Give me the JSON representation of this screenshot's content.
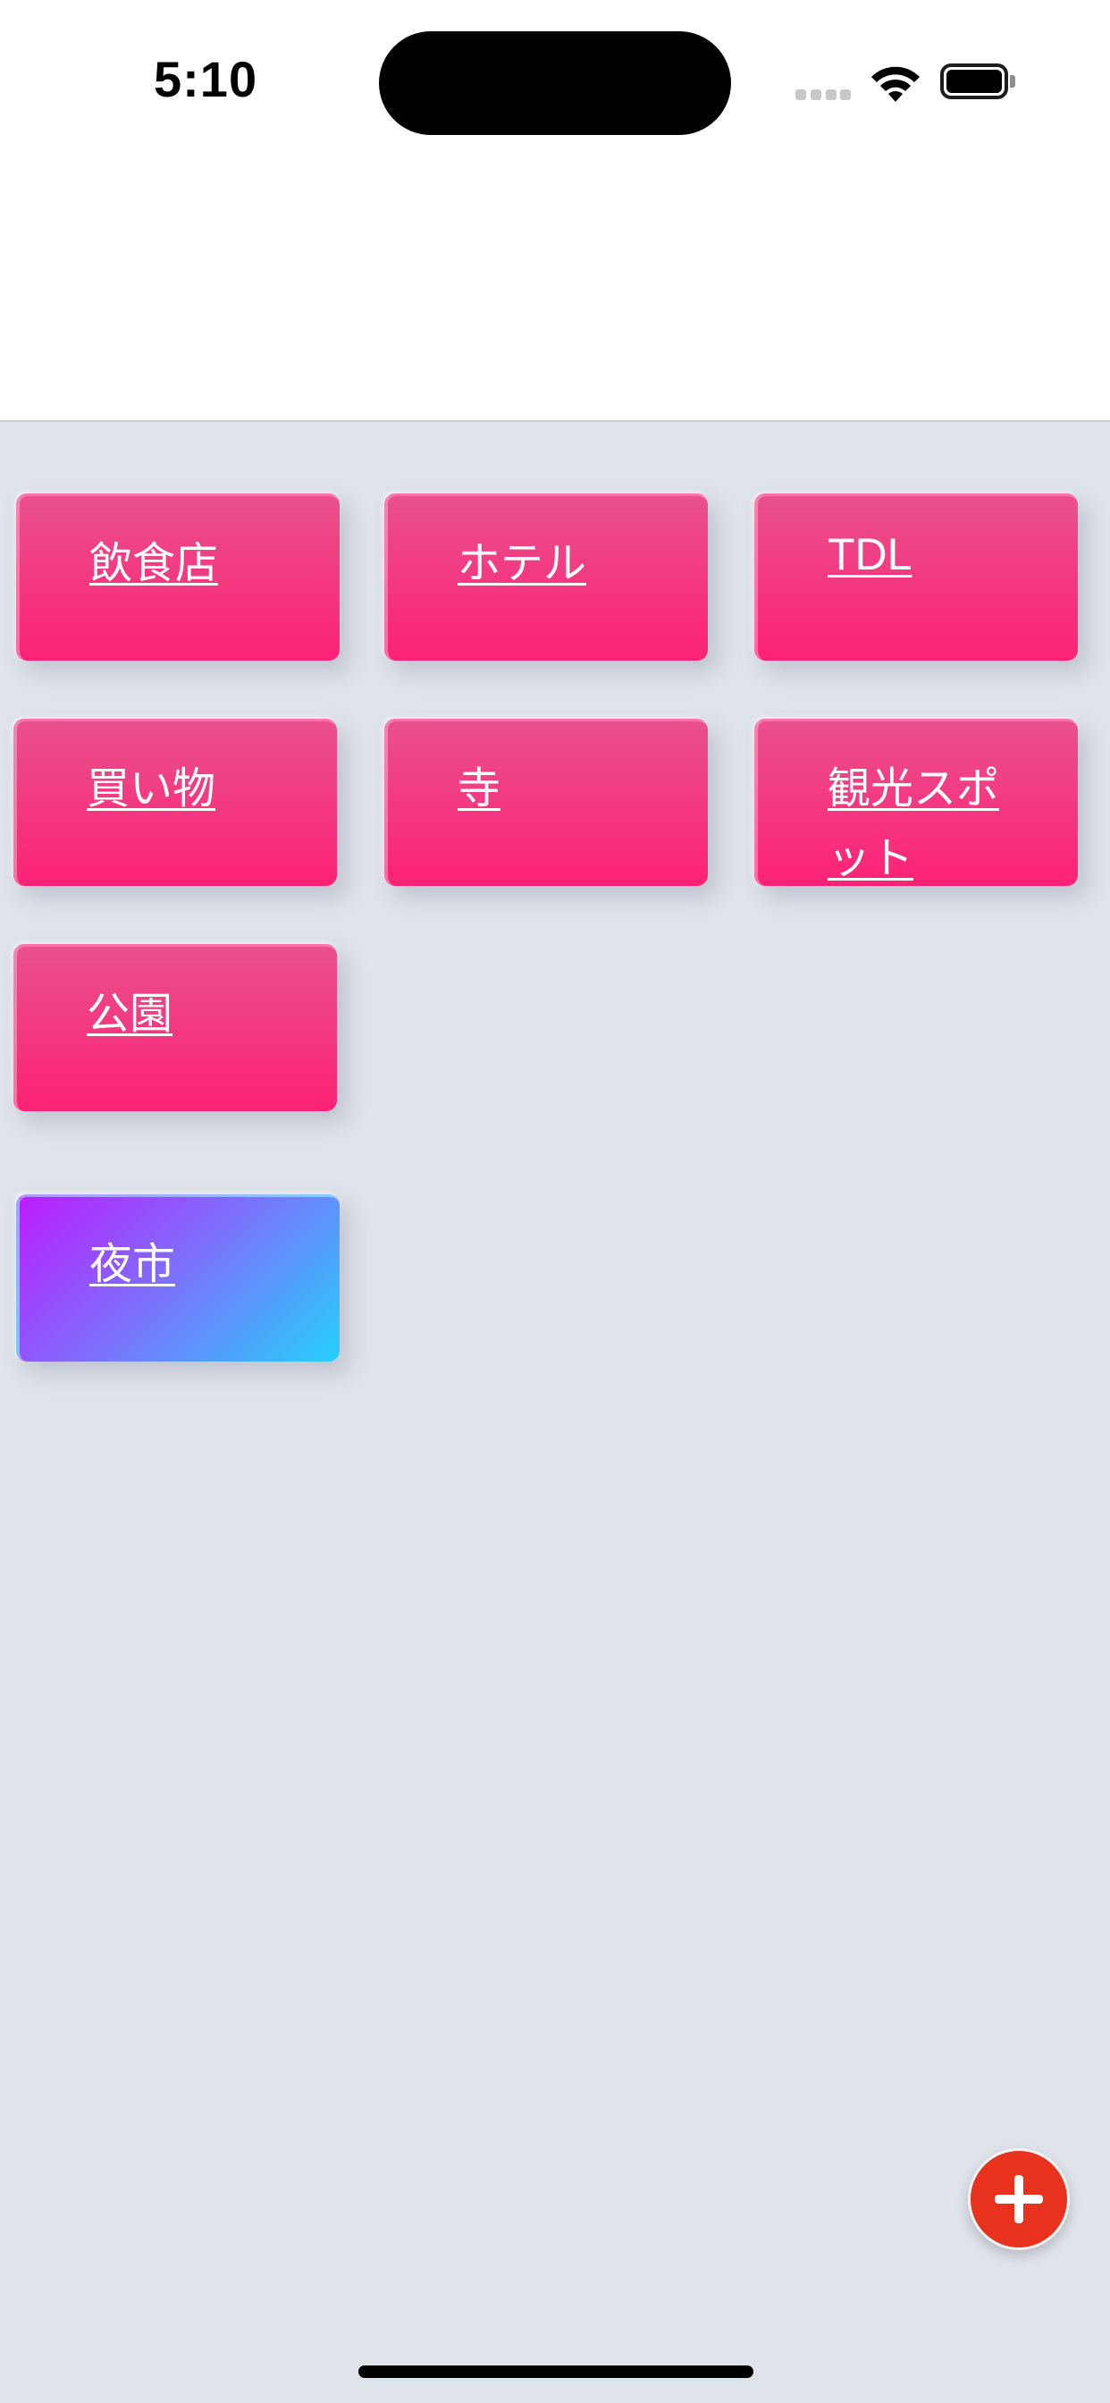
{
  "status_bar": {
    "time": "5:10"
  },
  "tiles": [
    {
      "label": "飲食店",
      "style": "pink"
    },
    {
      "label": "ホテル",
      "style": "pink"
    },
    {
      "label": "TDL",
      "style": "pink"
    },
    {
      "label": "買い物",
      "style": "pink"
    },
    {
      "label": "寺",
      "style": "pink"
    },
    {
      "label": "観光スポット",
      "style": "pink"
    },
    {
      "label": "公園",
      "style": "pink"
    },
    {
      "label": "夜市",
      "style": "gradient-purple-cyan"
    }
  ],
  "fab": {
    "icon": "plus-icon",
    "color": "#e8321e"
  },
  "colors": {
    "tile_pink_top": "#e9508c",
    "tile_pink_bottom": "#fd2276",
    "tile_special_start": "#bc1cff",
    "tile_special_end": "#24d0fb",
    "background": "#dfe3ea"
  }
}
